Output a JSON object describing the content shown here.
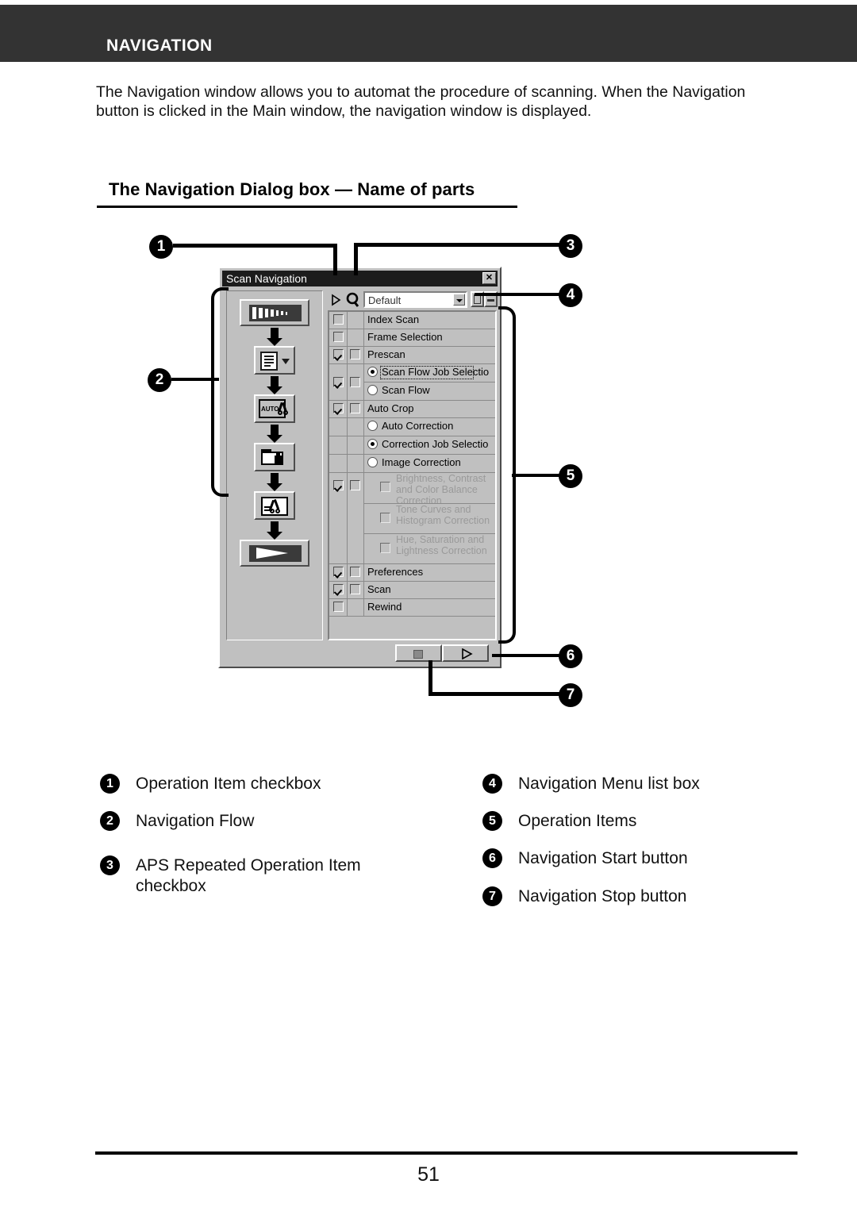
{
  "header": {
    "title": "NAVIGATION"
  },
  "intro": {
    "paragraph": "The Navigation window allows you to automat the procedure of scanning. When the Navigation button is clicked in the Main window, the navigation window is displayed."
  },
  "section": {
    "heading": "The Navigation Dialog box — Name of parts"
  },
  "dialog": {
    "title": "Scan Navigation",
    "close_label": "✕",
    "toolbar": {
      "play_icon": "play-triangle-icon",
      "scan_icon": "scan-magnifier-icon",
      "menu_value": "Default",
      "menu_placeholder": "Default",
      "dropdown_icon": "chevron-down-icon",
      "button1_icon": "save-job-icon",
      "button2_icon": "more-options-icon"
    },
    "flow_items": [
      {
        "name": "film-strip-icon",
        "type": "wide"
      },
      {
        "name": "frame-list-dropdown-icon",
        "type": "narrow"
      },
      {
        "name": "auto-crop-icon",
        "type": "narrow"
      },
      {
        "name": "folder-correction-icon",
        "type": "narrow"
      },
      {
        "name": "image-correction-icon",
        "type": "narrow"
      },
      {
        "name": "scan-start-icon",
        "type": "wide"
      }
    ],
    "rows": [
      {
        "label": "Index Scan",
        "c1": "unchecked",
        "c2": "none",
        "kind": "item",
        "dim": false
      },
      {
        "label": "Frame Selection",
        "c1": "unchecked",
        "c2": "none",
        "kind": "item",
        "dim": false
      },
      {
        "label": "Prescan",
        "c1": "checked",
        "c2": "unchecked",
        "kind": "item",
        "dim": false
      },
      {
        "label": "Scan Flow Job Selectio",
        "c1": "checked",
        "c2": "unchecked",
        "kind": "radio-selected-focus",
        "dim": false
      },
      {
        "label": "Scan Flow",
        "c1": "none",
        "c2": "none",
        "kind": "radio",
        "dim": false
      },
      {
        "label": "Auto Crop",
        "c1": "checked",
        "c2": "unchecked",
        "kind": "item",
        "dim": false
      },
      {
        "label": "Auto Correction",
        "c1": "none",
        "c2": "none",
        "kind": "radio",
        "dim": false
      },
      {
        "label": "Correction Job Selectio",
        "c1": "none",
        "c2": "none",
        "kind": "radio-selected",
        "dim": false
      },
      {
        "label": "Image Correction",
        "c1": "none",
        "c2": "none",
        "kind": "radio",
        "dim": false
      },
      {
        "label": "Brightness, Contrast and Color Balance Correction",
        "c1": "checked",
        "c2": "unchecked",
        "kind": "subcheck",
        "dim": true
      },
      {
        "label": "Tone Curves and Histogram Correction",
        "c1": "none",
        "c2": "none",
        "kind": "subcheck",
        "dim": true
      },
      {
        "label": "Hue, Saturation and Lightness Correction",
        "c1": "none",
        "c2": "none",
        "kind": "subcheck",
        "dim": true
      },
      {
        "label": "Preferences",
        "c1": "checked",
        "c2": "unchecked",
        "kind": "item",
        "dim": false
      },
      {
        "label": "Scan",
        "c1": "checked",
        "c2": "unchecked",
        "kind": "item",
        "dim": false
      },
      {
        "label": "Rewind",
        "c1": "unchecked",
        "c2": "none",
        "kind": "item",
        "dim": false
      }
    ],
    "transport": {
      "stop_icon": "stop-square-icon",
      "start_icon": "play-triangle-icon"
    }
  },
  "callouts": [
    {
      "n": "1"
    },
    {
      "n": "2"
    },
    {
      "n": "3"
    },
    {
      "n": "4"
    },
    {
      "n": "5"
    },
    {
      "n": "6"
    },
    {
      "n": "7"
    }
  ],
  "legend": {
    "left": [
      {
        "n": "1",
        "text": "Operation Item checkbox"
      },
      {
        "n": "2",
        "text": "Navigation Flow"
      },
      {
        "n": "3",
        "text": "APS Repeated Operation Item checkbox"
      }
    ],
    "right": [
      {
        "n": "4",
        "text": "Navigation Menu list box"
      },
      {
        "n": "5",
        "text": "Operation Items"
      },
      {
        "n": "6",
        "text": "Navigation Start button"
      },
      {
        "n": "7",
        "text": "Navigation Stop button"
      }
    ]
  },
  "footer": {
    "page_number": "51"
  },
  "colors": {
    "header_bg": "#333333",
    "dialog_face": "#c0c0c0",
    "titlebar_bg": "#1c1c1c",
    "dim_text": "#9a9a9a"
  }
}
